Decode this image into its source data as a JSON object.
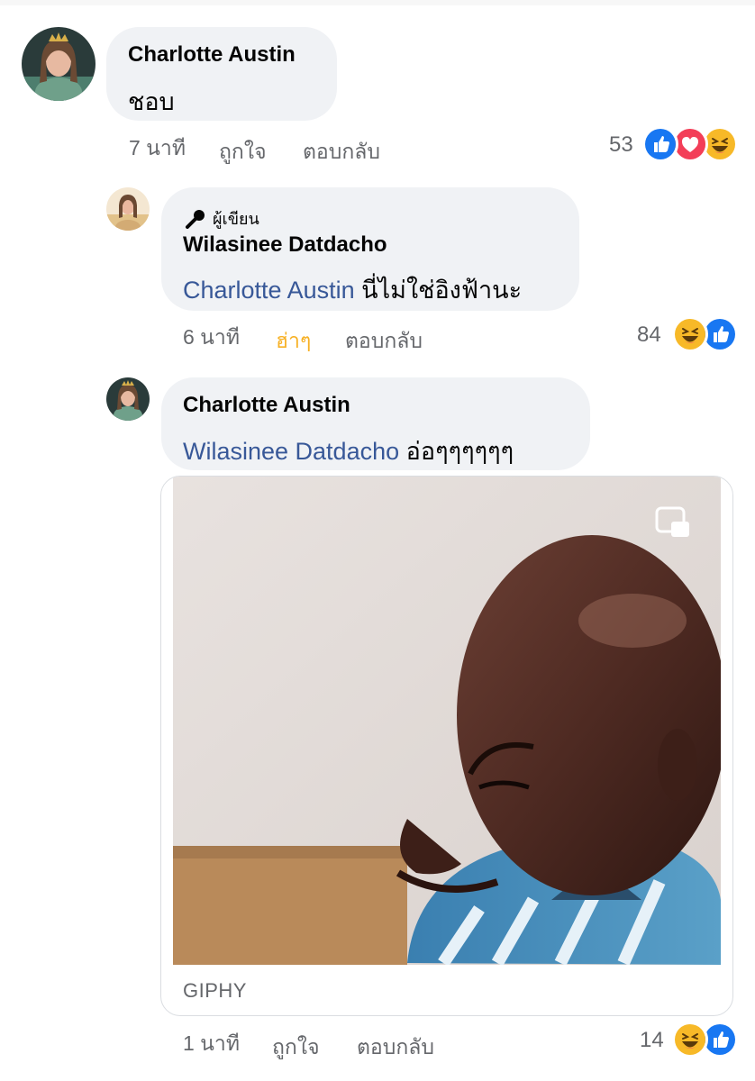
{
  "comments": [
    {
      "author": "Charlotte Austin",
      "text": "ชอบ",
      "time": "7 นาที",
      "like_label": "ถูกใจ",
      "reply_label": "ตอบกลับ",
      "reaction_count": "53",
      "reactions": [
        "like-icon",
        "love-icon",
        "haha-icon"
      ]
    },
    {
      "badge": "ผู้เขียน",
      "author": "Wilasinee Datdacho",
      "mention": "Charlotte Austin",
      "text": " นี่ไม่ใช่อิงฟ้านะ",
      "time": "6 นาที",
      "like_label": "ฮ่าๆ",
      "reply_label": "ตอบกลับ",
      "reaction_count": "84",
      "reactions": [
        "haha-icon",
        "like-icon"
      ]
    },
    {
      "author": "Charlotte Austin",
      "mention": "Wilasinee Datdacho",
      "text": " อ่อๆๆๆๆๆๆ",
      "gif_label": "GIPHY",
      "time": "1 นาที",
      "like_label": "ถูกใจ",
      "reply_label": "ตอบกลับ",
      "reaction_count": "14",
      "reactions": [
        "haha-icon",
        "like-icon"
      ]
    }
  ],
  "colors": {
    "bubble": "#f0f2f5",
    "mention": "#385898",
    "meta": "#65676b",
    "haha_active": "#f7b125",
    "like_blue": "#1877f2",
    "love_red": "#f33e58",
    "haha_yellow": "#f7b928"
  }
}
